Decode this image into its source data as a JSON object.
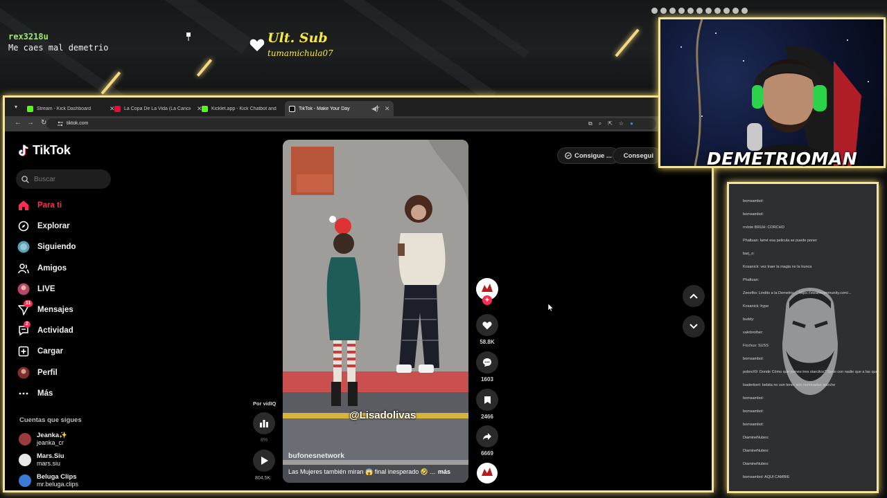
{
  "overlay": {
    "chat_user": "rex3218u",
    "chat_message": "Me caes mal demetrio",
    "last_sub_title": "Ult. Sub",
    "last_sub_name": "tumamichula07",
    "streamer_name": "DEMETRIOMAN",
    "side_chat": [
      "bomsambol:",
      "bomsambol:",
      "rrvlote BRUH: CORCHO",
      "Phaltuan: lamé esa pelicula se puede poner",
      "barj_o:",
      "Kosanick: vez traer la magia no la trunca",
      "Phaltuan:",
      "Zeeefito: Lindito a la Demetrio ... https://steamcommunity.com/...",
      "Kosanick: hype",
      "buddy:",
      "xakrbrother:",
      "Ficchus: SUSS",
      "bomsambol:",
      "pobreX9: Donde Cómo que comes tres starcitos? Serio con nadie que a las que por hace eso",
      "loaderbert: bebita no son tener son nominadas anoche",
      "bomsambol:",
      "bomsambol:",
      "bomsambol:",
      "DiamineNubes:",
      "DiamineNubes:",
      "DiamineNubes:",
      "bomsambol: AQUI CAMBIE"
    ]
  },
  "browser": {
    "tabs": [
      {
        "label": "Stream - Kick Dashboard",
        "color": "#53fc18"
      },
      {
        "label": "La Copa De La Vida (La Canción...",
        "color": "#ff0033"
      },
      {
        "label": "Kicklet.app - Kick Chatbot and ...",
        "color": "#53fc18"
      },
      {
        "label": "TikTok - Make Your Day",
        "color": "#ffffff"
      }
    ],
    "url": "tiktok.com"
  },
  "tiktok": {
    "logo": "TikTok",
    "search_placeholder": "Buscar",
    "nav": [
      {
        "label": "Para ti",
        "icon": "home-icon",
        "active": true
      },
      {
        "label": "Explorar",
        "icon": "compass-icon"
      },
      {
        "label": "Siguiendo",
        "icon": "following-avatar-icon"
      },
      {
        "label": "Amigos",
        "icon": "friends-icon"
      },
      {
        "label": "LIVE",
        "icon": "live-avatar-icon"
      },
      {
        "label": "Mensajes",
        "icon": "messages-icon",
        "badge": "11"
      },
      {
        "label": "Actividad",
        "icon": "activity-icon",
        "badge": "2"
      },
      {
        "label": "Cargar",
        "icon": "upload-icon"
      },
      {
        "label": "Perfil",
        "icon": "profile-avatar-icon"
      },
      {
        "label": "Más",
        "icon": "more-icon"
      }
    ],
    "following_title": "Cuentas que sigues",
    "following": [
      {
        "name": "Jeanka✨",
        "handle": "jeanka_cr",
        "color": "#9b3b3b"
      },
      {
        "name": "Mars.Siu",
        "handle": "mars.siu",
        "color": "#e8e8e8"
      },
      {
        "name": "Beluga Clips",
        "handle": "mr.beluga.clips",
        "color": "#3a7bd5"
      }
    ],
    "top_buttons": [
      "Consigue ...",
      "Consegui"
    ],
    "video": {
      "caption_tag": "@Lisadolivas",
      "author": "bufonesnetwork",
      "description": "Las Mujeres también miran 😱 final inesperado 🤣 ...",
      "more": "más"
    },
    "actions": {
      "likes": "58.8K",
      "comments": "1603",
      "saves": "2466",
      "shares": "6669"
    },
    "vidiq": {
      "label": "Por vidIQ",
      "percent": "8%",
      "views": "804.5K"
    }
  }
}
